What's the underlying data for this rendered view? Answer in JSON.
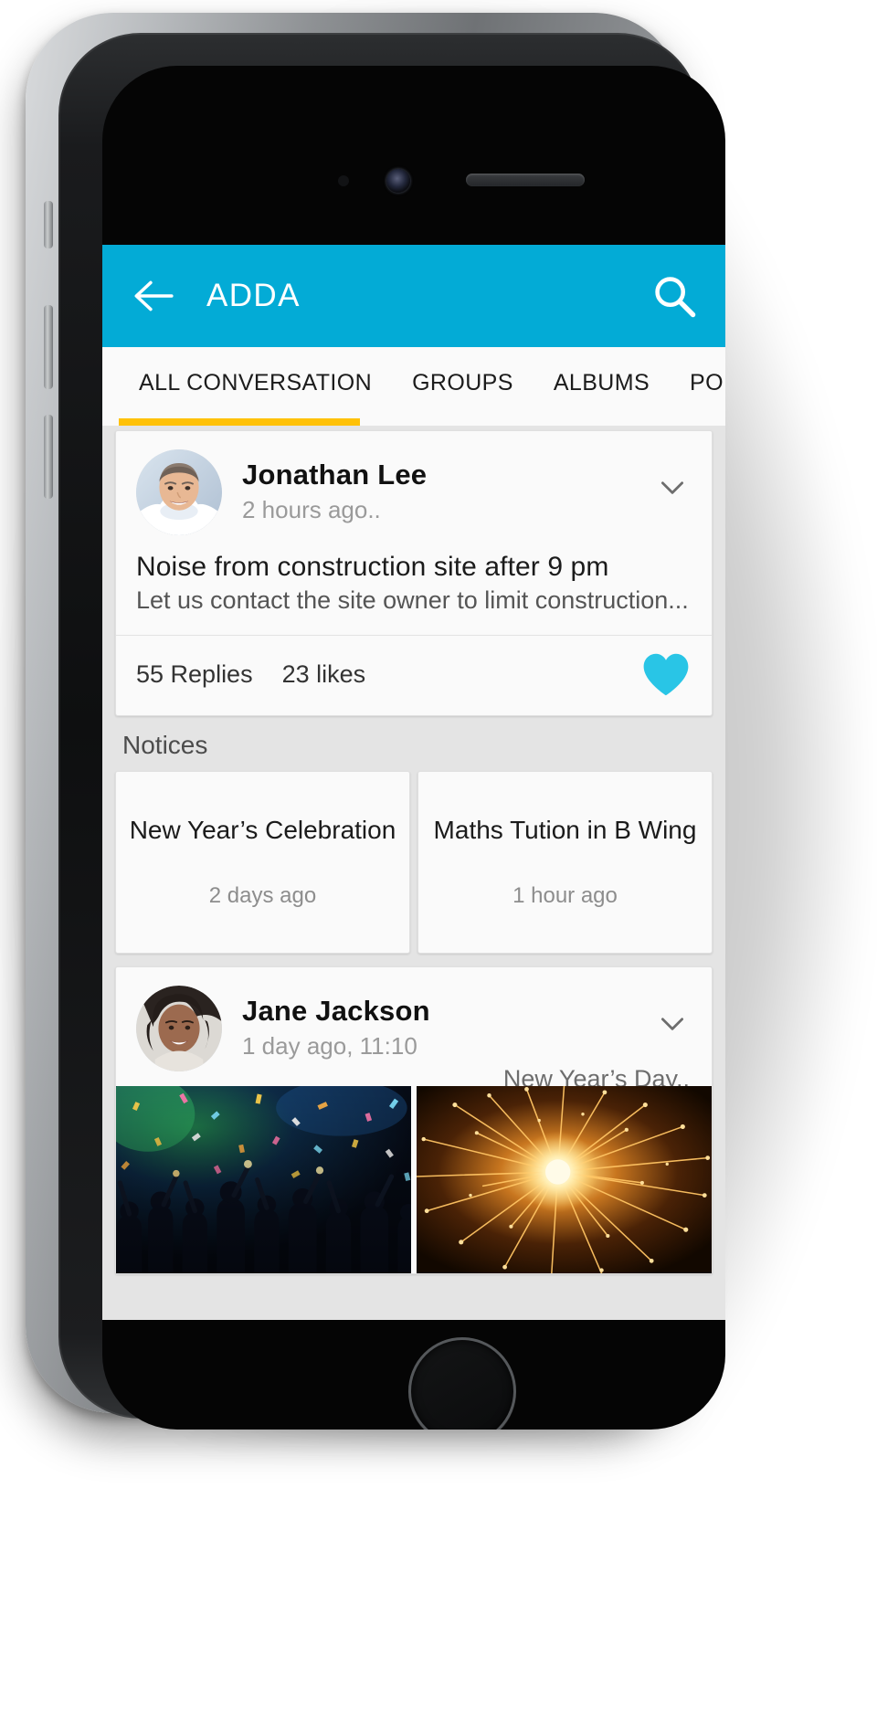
{
  "appbar": {
    "title": "ADDA",
    "back_icon": "arrow-left-icon",
    "search_icon": "search-icon",
    "background_color": "#03ABD6",
    "text_color": "#FFFFFF"
  },
  "tabs": {
    "active_index": 0,
    "indicator_color": "#FFC107",
    "items": [
      {
        "label": "ALL CONVERSATION"
      },
      {
        "label": "GROUPS"
      },
      {
        "label": "ALBUMS"
      },
      {
        "label": "POL"
      }
    ]
  },
  "feed": {
    "post1": {
      "author": "Jonathan Lee",
      "time": "2 hours ago..",
      "title": "Noise from construction site after 9 pm",
      "snippet": "Let us contact the site owner to limit construction...",
      "replies": "55 Replies",
      "likes": "23 likes",
      "liked": true,
      "like_icon": "heart-icon",
      "like_color": "#29C5E6",
      "menu_icon": "chevron-down-icon",
      "avatar_icon": "avatar"
    },
    "notices": {
      "section_label": "Notices",
      "items": [
        {
          "title": "New Year’s Celebration",
          "time": "2 days ago"
        },
        {
          "title": "Maths Tution in B Wing",
          "time": "1 hour ago"
        }
      ]
    },
    "post2": {
      "author": "Jane Jackson",
      "time": "1 day ago, 11:10",
      "album_label": "New Year’s Day..",
      "menu_icon": "chevron-down-icon",
      "avatar_icon": "avatar",
      "photos": [
        {
          "caption": "confetti-crowd-celebration-photo"
        },
        {
          "caption": "fireworks-burst-photo"
        }
      ]
    }
  }
}
